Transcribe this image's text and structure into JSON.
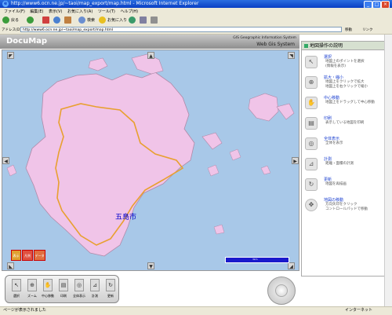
{
  "window": {
    "title": "http://www6.ocn.ne.jp/~taoi/map_export/map.html - Microsoft Internet Explorer",
    "minimize": "_",
    "maximize": "□",
    "close": "×"
  },
  "menu": {
    "items": [
      "ファイル(F)",
      "編集(E)",
      "表示(V)",
      "お気に入り(A)",
      "ツール(T)",
      "ヘルプ(H)"
    ]
  },
  "toolbar": {
    "back": "戻る",
    "search": "検索",
    "favorites": "お気に入り"
  },
  "address": {
    "label": "アドレス(D)",
    "url": "http://www6.ocn.ne.jp/~taoi/map_export/map.html",
    "go": "移動",
    "links": "リンク"
  },
  "app": {
    "logo": "DocuMap",
    "subtitle1": "GIS Geographic Information System",
    "subtitle2": "Web Gis System"
  },
  "map": {
    "city_label": "五島市",
    "legend_buttons": [
      "表示",
      "凡例",
      "データ"
    ],
    "scale_label": "3km",
    "colors": {
      "sea": "#a8c8e8",
      "land": "#f0c4e8",
      "boundary": "#e8a030"
    }
  },
  "panel": {
    "title": "地図操作の説明",
    "items": [
      {
        "title": "選択",
        "desc1": "地図上のポイントを選択",
        "desc2": "(情報を表示)",
        "icon": "pointer-icon"
      },
      {
        "title": "拡大・縮小",
        "desc1": "地図上をクリックで拡大",
        "desc2": "地図上を右クリックで縮小",
        "icon": "zoom-icon"
      },
      {
        "title": "中心移動",
        "desc1": "地図上をドラッグして中心移動",
        "desc2": "",
        "icon": "hand-icon"
      },
      {
        "title": "印刷",
        "desc1": "表示している地図を印刷",
        "desc2": "",
        "icon": "print-icon"
      },
      {
        "title": "全体表示",
        "desc1": "全体を表示",
        "desc2": "",
        "icon": "globe-icon"
      },
      {
        "title": "計測",
        "desc1": "距離・面積の計測",
        "desc2": "",
        "icon": "ruler-icon"
      },
      {
        "title": "更新",
        "desc1": "地図を再描画",
        "desc2": "",
        "icon": "refresh-icon"
      },
      {
        "title": "地図の移動",
        "desc1": "方向矢印をクリック",
        "desc2": "コントロールパッドで移動",
        "icon": "dpad-icon"
      }
    ]
  },
  "tools": [
    {
      "label": "選択",
      "icon": "pointer-icon"
    },
    {
      "label": "ズーム",
      "icon": "zoom-icon"
    },
    {
      "label": "中心移動",
      "icon": "hand-icon"
    },
    {
      "label": "印刷",
      "icon": "print-icon"
    },
    {
      "label": "全体表示",
      "icon": "globe-icon"
    },
    {
      "label": "計測",
      "icon": "ruler-icon"
    },
    {
      "label": "更新",
      "icon": "refresh-icon"
    }
  ],
  "status": {
    "text": "ページが表示されました",
    "zone": "インターネット"
  }
}
